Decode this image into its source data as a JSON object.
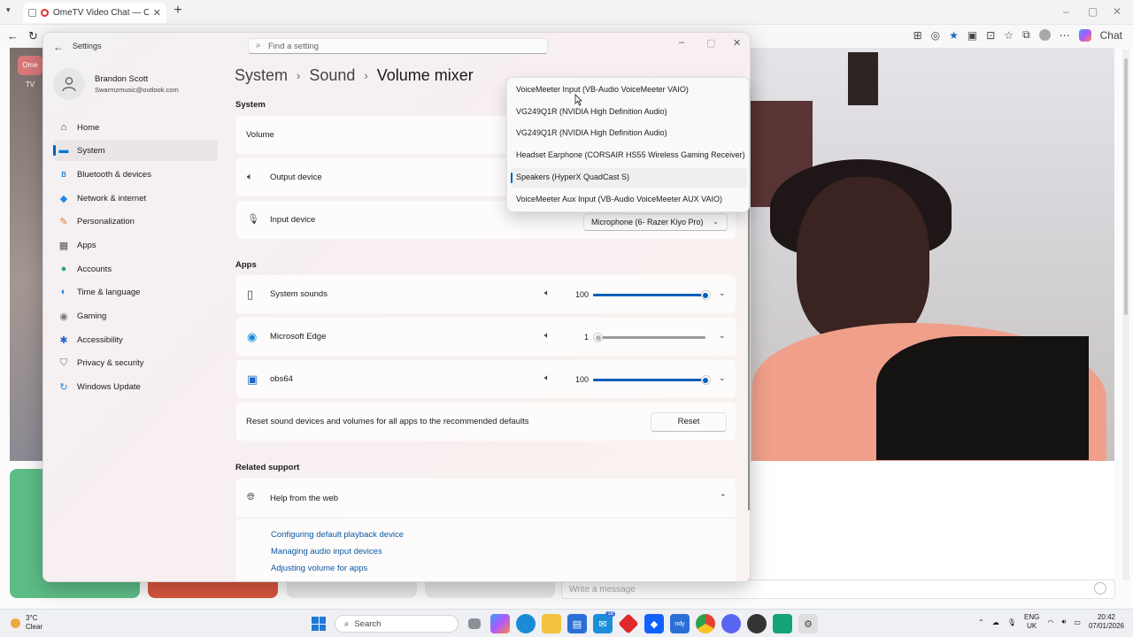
{
  "browser": {
    "tab_title": "OmeTV Video Chat — Omeg…",
    "new_tab": "+",
    "chat_label": "Chat"
  },
  "omegle": {
    "logo": "Ome TV",
    "message_placeholder": "Write a message"
  },
  "settings": {
    "window_title": "Settings",
    "search_placeholder": "Find a setting",
    "user": {
      "name": "Brandon Scott",
      "email": "Swarmzmusic@outlook.com"
    },
    "nav": [
      {
        "label": "Home",
        "icon": "home-icon",
        "glyph": "⌂",
        "color": "#333333"
      },
      {
        "label": "System",
        "icon": "monitor-icon",
        "glyph": "▬",
        "color": "#0078d4",
        "active": true
      },
      {
        "label": "Bluetooth & devices",
        "icon": "bluetooth-icon",
        "glyph": "ʙ",
        "color": "#0078d4"
      },
      {
        "label": "Network & internet",
        "icon": "wifi-icon",
        "glyph": "◆",
        "color": "#1e88e5"
      },
      {
        "label": "Personalization",
        "icon": "brush-icon",
        "glyph": "✎",
        "color": "#e07a2e"
      },
      {
        "label": "Apps",
        "icon": "apps-icon",
        "glyph": "▦",
        "color": "#555555"
      },
      {
        "label": "Accounts",
        "icon": "accounts-icon",
        "glyph": "●",
        "color": "#2fa86a"
      },
      {
        "label": "Time & language",
        "icon": "globe-clock-icon",
        "glyph": "◐",
        "color": "#1e88e5"
      },
      {
        "label": "Gaming",
        "icon": "gamepad-icon",
        "glyph": "◉",
        "color": "#777777"
      },
      {
        "label": "Accessibility",
        "icon": "accessibility-icon",
        "glyph": "✱",
        "color": "#1e66c8"
      },
      {
        "label": "Privacy & security",
        "icon": "shield-icon",
        "glyph": "⛉",
        "color": "#777777"
      },
      {
        "label": "Windows Update",
        "icon": "update-icon",
        "glyph": "↻",
        "color": "#1e88e5"
      }
    ],
    "breadcrumb": {
      "first": "System",
      "second": "Sound",
      "current": "Volume mixer",
      "sep": "›"
    },
    "system_section": "System",
    "volume_label": "Volume",
    "output_label": "Output device",
    "input_label": "Input device",
    "input_value": "Microphone (6- Razer Kiyo Pro)",
    "apps_section": "Apps",
    "apps": [
      {
        "name": "System sounds",
        "icon": "speaker-box-icon",
        "volume": "100",
        "level": 100
      },
      {
        "name": "Microsoft Edge",
        "icon": "edge-icon",
        "volume": "1",
        "level": 1
      },
      {
        "name": "obs64",
        "icon": "obs-icon",
        "volume": "100",
        "level": 100
      }
    ],
    "reset_text": "Reset sound devices and volumes for all apps to the recommended defaults",
    "reset_button": "Reset",
    "related_section": "Related support",
    "help_label": "Help from the web",
    "support_links": [
      "Configuring default playback device",
      "Managing audio input devices",
      "Adjusting volume for apps"
    ]
  },
  "output_dropdown": {
    "items": [
      {
        "label": "VoiceMeeter Input (VB-Audio VoiceMeeter VAIO)"
      },
      {
        "label": "VG249Q1R (NVIDIA High Definition Audio)"
      },
      {
        "label": "VG249Q1R (NVIDIA High Definition Audio)"
      },
      {
        "label": "Headset Earphone (CORSAIR HS55 Wireless Gaming Receiver)"
      },
      {
        "label": "Speakers (HyperX QuadCast S)",
        "selected": true
      },
      {
        "label": "VoiceMeeter Aux Input (VB-Audio VoiceMeeter AUX VAIO)"
      }
    ]
  },
  "taskbar": {
    "weather_temp": "3°C",
    "weather_desc": "Clear",
    "search_label": "Search",
    "lang_top": "ENG",
    "lang_bottom": "UK",
    "time": "20:42",
    "date": "07/01/2026",
    "badge": "18"
  },
  "colors": {
    "accent": "#005fb8",
    "link": "#0b5aa6"
  }
}
